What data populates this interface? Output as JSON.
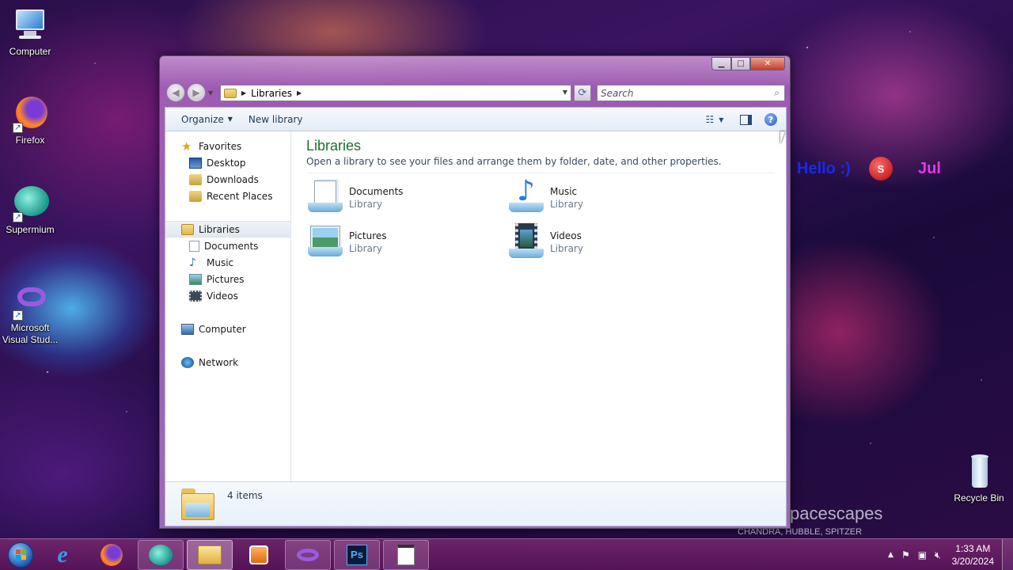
{
  "desktop": {
    "icons": [
      {
        "label": "Computer"
      },
      {
        "label": "Firefox"
      },
      {
        "label": "Supermium"
      },
      {
        "label": "Microsoft Visual Stud..."
      },
      {
        "label": "Recycle Bin"
      }
    ],
    "widgets": {
      "hello_text": "Hello :)",
      "s_badge": "S",
      "jul_text": "Jul"
    },
    "watermark": {
      "title": "pacescapes",
      "subtitle": "CHANDRA, HUBBLE, SPITZER"
    }
  },
  "window": {
    "address": {
      "crumb": "Libraries"
    },
    "search": {
      "placeholder": "Search"
    },
    "toolbar": {
      "organize_label": "Organize",
      "new_library_label": "New library"
    },
    "nav": {
      "favorites": "Favorites",
      "favorites_items": [
        "Desktop",
        "Downloads",
        "Recent Places"
      ],
      "libraries": "Libraries",
      "libraries_items": [
        "Documents",
        "Music",
        "Pictures",
        "Videos"
      ],
      "computer": "Computer",
      "network": "Network"
    },
    "main": {
      "title": "Libraries",
      "description": "Open a library to see your files and arrange them by folder, date, and other properties.",
      "libraries": [
        {
          "name": "Documents",
          "type": "Library"
        },
        {
          "name": "Music",
          "type": "Library"
        },
        {
          "name": "Pictures",
          "type": "Library"
        },
        {
          "name": "Videos",
          "type": "Library"
        }
      ]
    },
    "details": {
      "count": "4 items"
    }
  },
  "taskbar": {
    "clock_time": "1:33 AM",
    "clock_date": "3/20/2024"
  }
}
